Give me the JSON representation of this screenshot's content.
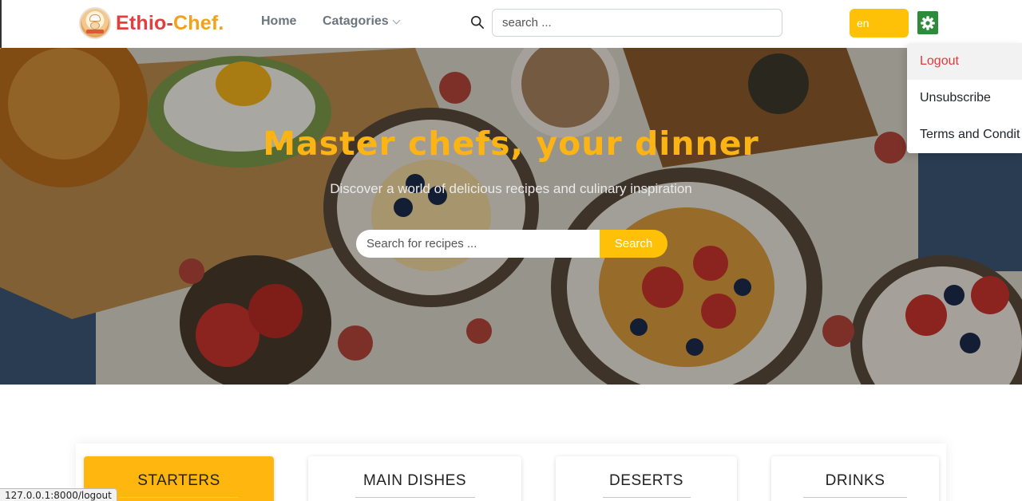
{
  "brand": {
    "name_part1": "Ethio-",
    "name_part2": "Chef.",
    "logo_icon": "chef-logo-icon"
  },
  "nav": {
    "home": "Home",
    "categories": "Catagories"
  },
  "search": {
    "placeholder": "search ..."
  },
  "language": {
    "value": "en"
  },
  "settings_menu": {
    "items": [
      {
        "label": "Logout"
      },
      {
        "label": "Unsubscribe"
      },
      {
        "label": "Terms and Condit"
      }
    ]
  },
  "hero": {
    "title": "Master chefs, your dinner",
    "subtitle": "Discover a world of delicious recipes and culinary inspiration",
    "search_placeholder": "Search for recipes ...",
    "search_button": "Search"
  },
  "categories": [
    {
      "label": "STARTERS"
    },
    {
      "label": "MAIN DISHES"
    },
    {
      "label": "DESERTS"
    },
    {
      "label": "DRINKS"
    }
  ],
  "status_url": "127.0.0.1:8000/logout",
  "colors": {
    "accent": "#ffc107",
    "brand_red": "#e13f3f",
    "brand_orange": "#f4a11a",
    "hero_title": "#fcb414",
    "gear_green": "#2e8b3a"
  }
}
